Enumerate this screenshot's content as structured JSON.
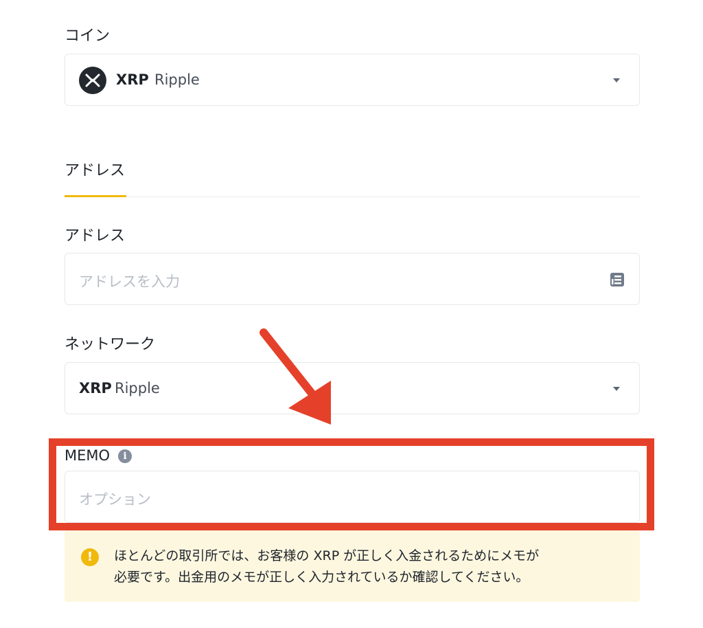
{
  "coin": {
    "label": "コイン",
    "symbol": "XRP",
    "name": "Ripple",
    "icon": "xrp-logo-icon",
    "dropdown_icon": "caret-down-icon"
  },
  "tabs": [
    {
      "label": "アドレス",
      "active": true
    }
  ],
  "address": {
    "label": "アドレス",
    "placeholder": "アドレスを入力",
    "icon": "address-book-icon"
  },
  "network": {
    "label": "ネットワーク",
    "symbol": "XRP",
    "name": "Ripple",
    "dropdown_icon": "caret-down-icon"
  },
  "memo": {
    "label": "MEMO",
    "info_icon": "info-icon",
    "placeholder": "オプション"
  },
  "notice": {
    "icon": "warning-icon",
    "line1": "ほとんどの取引所では、お客様の XRP が正しく入金されるためにメモが",
    "line2": "必要です。出金用のメモが正しく入力されているか確認してください。"
  },
  "colors": {
    "accent": "#f0b90b",
    "annotation_red": "#e5412a",
    "notice_bg": "#fdf7e0",
    "warning": "#f0b90b"
  }
}
